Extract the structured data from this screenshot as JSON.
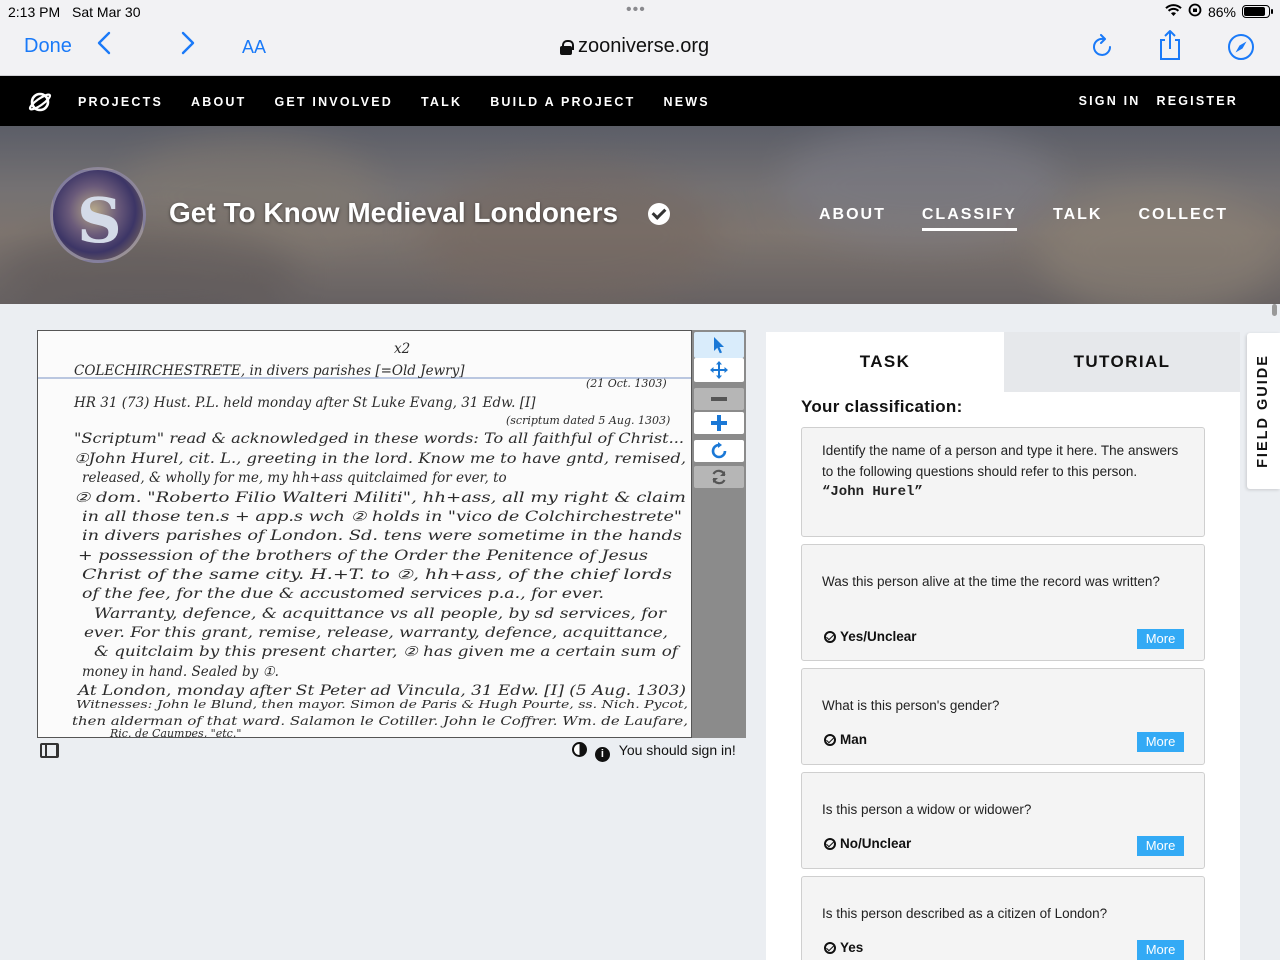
{
  "status_bar": {
    "time": "2:13 PM",
    "date": "Sat Mar 30",
    "battery": "86%",
    "battery_level": 0.86
  },
  "browser": {
    "done_label": "Done",
    "text_size_label": "AA",
    "url": "zooniverse.org",
    "icons": [
      "chevron-left-icon",
      "chevron-right-icon",
      "reload-icon",
      "share-icon",
      "compass-icon"
    ]
  },
  "site_nav": {
    "links": [
      "PROJECTS",
      "ABOUT",
      "GET INVOLVED",
      "TALK",
      "BUILD A PROJECT",
      "NEWS"
    ],
    "sign_in": "SIGN IN",
    "register": "REGISTER"
  },
  "project": {
    "title": "Get To Know Medieval Londoners",
    "nav": [
      "ABOUT",
      "CLASSIFY",
      "TALK",
      "COLLECT"
    ],
    "active_nav": "CLASSIFY"
  },
  "subject": {
    "lines": [
      "x2",
      "COLECHIRCHESTRETE, in divers parishes [=Old Jewry]",
      "(21 Oct. 1303)",
      "HR  31 (73)   Hust. P.L. held monday after St Luke Evang, 31 Edw. [I]",
      "(scriptum dated 5 Aug. 1303)",
      "\"Scriptum\" read & acknowledged in these words: To all faithful of Christ...",
      "①John Hurel, cit. L., greeting in the lord.  Know me to have gntd, remised,",
      "released, & wholly for me, my hh+ass quitclaimed for ever, to",
      "② dom. \"Roberto Filio Walteri Militi\", hh+ass, all my right & claim",
      "in all those ten.s + app.s  wch ② holds in \"vico de Colchirchestrete\"",
      "in divers parishes of London.  Sd. tens were sometime in the hands",
      "+ possession of the brothers of the Order the Penitence of Jesus",
      "Christ of the same city.  H.+T. to ②, hh+ass, of the chief lords",
      "of the fee, for the due & accustomed services p.a., for ever.",
      "Warranty, defence, & acquittance vs all people, by sd services, for",
      "ever.  For this grant, remise, release, warranty, defence, acquittance,",
      "& quitclaim by this present charter, ② has given me a certain sum of",
      "money in hand.  Sealed by ①.",
      "At London, monday after St Peter ad Vincula, 31 Edw. [I] (5 Aug. 1303)",
      "Witnesses: John le Blund, then mayor. Simon de Paris & Hugh Pourte, ss. Nich. Pycot,",
      "then alderman of that ward. Salamon le Cotiller. John le Coffrer. Wm. de Laufare,",
      "Ric. de Caumpes, \"etc.\""
    ],
    "sign_in_notice": "You should sign in!"
  },
  "toolbar": {
    "tools": [
      "pointer-icon",
      "move-icon",
      "zoom-out-icon",
      "zoom-in-icon",
      "rotate-icon",
      "reset-icon"
    ],
    "active_tool": "pointer-icon"
  },
  "panel": {
    "tabs": [
      "TASK",
      "TUTORIAL"
    ],
    "active_tab": "TASK",
    "heading": "Your classification:",
    "more_label": "More",
    "cards": [
      {
        "question": "Identify the name of a person and type it here. The answers to the following questions should refer to this person.",
        "answer": "“John Hurel”"
      },
      {
        "question": "Was this person alive at the time the record was written?",
        "answer": "Yes/Unclear"
      },
      {
        "question": "What is this person's gender?",
        "answer": "Man"
      },
      {
        "question": "Is this person a widow or widower?",
        "answer": "No/Unclear"
      },
      {
        "question": "Is this person described as a citizen of London?",
        "answer": "Yes"
      }
    ]
  },
  "field_guide": "FIELD GUIDE",
  "colors": {
    "ios_blue": "#1a7af8",
    "nav_bg": "#000000",
    "more_button": "#33aaf5",
    "page_bg": "#ebeef2"
  }
}
